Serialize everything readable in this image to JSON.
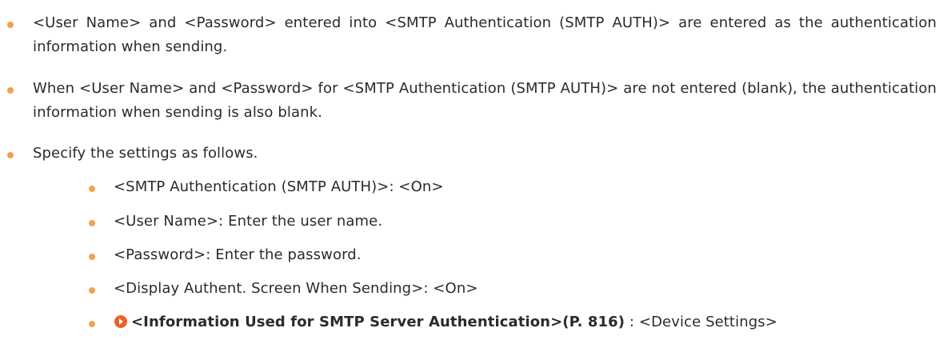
{
  "bullet_color": "#f0a24e",
  "link_icon_color": "#e8642a",
  "items": [
    {
      "text": "<User Name> and <Password> entered into <SMTP Authentication (SMTP AUTH)> are entered as the authentication information when sending."
    },
    {
      "text": "When <User Name> and <Password> for <SMTP Authentication (SMTP AUTH)> are not entered (blank), the authentication information when sending is also blank."
    },
    {
      "text": "Specify the settings as follows."
    }
  ],
  "subitems": [
    {
      "text": "<SMTP Authentication (SMTP AUTH)>: <On>"
    },
    {
      "text": "<User Name>: Enter the user name."
    },
    {
      "text": "<Password>: Enter the password."
    },
    {
      "text": "<Display Authent. Screen When Sending>: <On>"
    }
  ],
  "reference_item": {
    "icon": "arrow-circle-icon",
    "link_text": "<Information Used for SMTP Server Authentication>(P. 816)",
    "suffix": " : <Device Settings>"
  }
}
